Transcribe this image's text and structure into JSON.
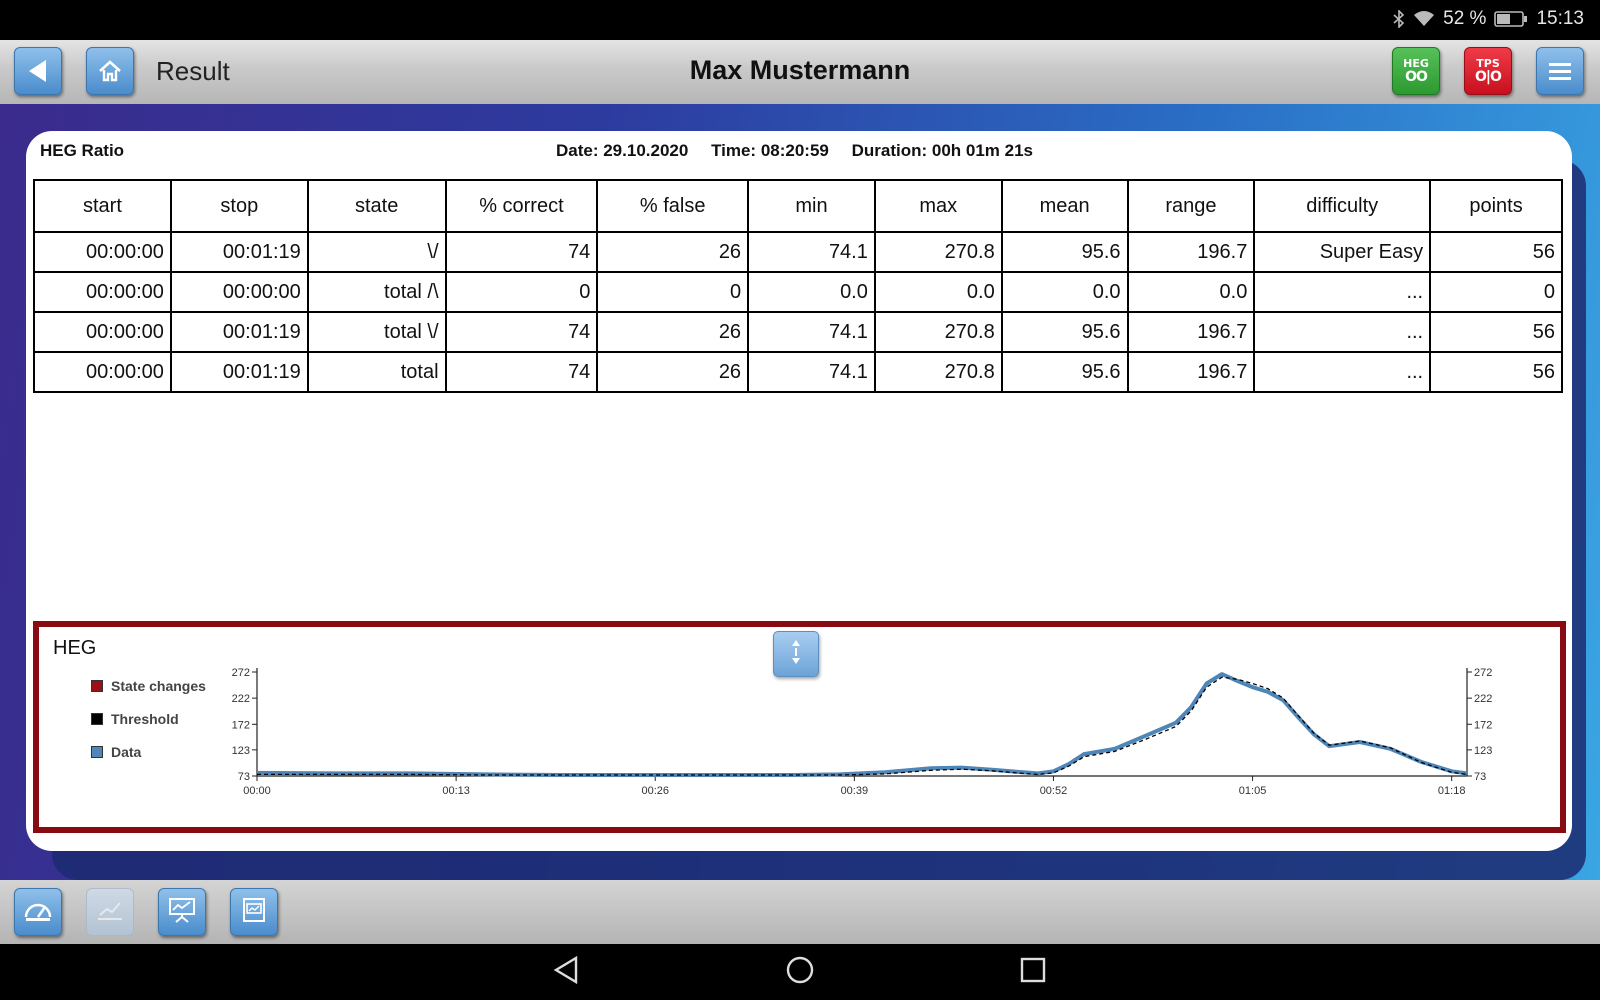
{
  "status_bar": {
    "battery_percent": "52 %",
    "time": "15:13",
    "icons": [
      "bluetooth-icon",
      "wifi-icon",
      "battery-icon"
    ]
  },
  "toolbar": {
    "title": "Result",
    "patient_name": "Max Mustermann",
    "heg_device": {
      "top": "HEG",
      "bottom": "OO"
    },
    "tps_device": {
      "top": "TPS",
      "bottom": "O|O"
    },
    "icons": [
      "back-arrow-icon",
      "home-icon",
      "menu-icon"
    ]
  },
  "card": {
    "title": "HEG Ratio",
    "date": "Date: 29.10.2020",
    "time": "Time: 08:20:59",
    "duration": "Duration: 00h 01m 21s"
  },
  "table": {
    "headers": [
      "start",
      "stop",
      "state",
      "% correct",
      "% false",
      "min",
      "max",
      "mean",
      "range",
      "difficulty",
      "points"
    ],
    "rows": [
      [
        "00:00:00",
        "00:01:19",
        "\\/",
        "74",
        "26",
        "74.1",
        "270.8",
        "95.6",
        "196.7",
        "Super Easy",
        "56"
      ],
      [
        "00:00:00",
        "00:00:00",
        "total /\\",
        "0",
        "0",
        "0.0",
        "0.0",
        "0.0",
        "0.0",
        "...",
        "0"
      ],
      [
        "00:00:00",
        "00:01:19",
        "total \\/",
        "74",
        "26",
        "74.1",
        "270.8",
        "95.6",
        "196.7",
        "...",
        "56"
      ],
      [
        "00:00:00",
        "00:01:19",
        "total",
        "74",
        "26",
        "74.1",
        "270.8",
        "95.6",
        "196.7",
        "...",
        "56"
      ]
    ]
  },
  "chart_panel": {
    "title": "HEG",
    "legend": [
      {
        "label": "State changes",
        "color": "#9b1016"
      },
      {
        "label": "Threshold",
        "color": "#000000"
      },
      {
        "label": "Data",
        "color": "#4f86b8"
      }
    ]
  },
  "chart_data": {
    "type": "line",
    "x_ticks": [
      "00:00",
      "00:13",
      "00:26",
      "00:39",
      "00:52",
      "01:05",
      "01:18"
    ],
    "x_tick_seconds": [
      0,
      13,
      26,
      39,
      52,
      65,
      78
    ],
    "xlim": [
      0,
      79
    ],
    "y_ticks": [
      73,
      123,
      172,
      222,
      272
    ],
    "ylim": [
      73,
      272
    ],
    "grid": false,
    "legend_position": "left",
    "series": [
      {
        "name": "Data",
        "color": "#4f86b8",
        "x": [
          0,
          5,
          10,
          15,
          20,
          25,
          30,
          35,
          38,
          41,
          44,
          46,
          48,
          50,
          51,
          52,
          53,
          54,
          56,
          58,
          60,
          61,
          62,
          63,
          64,
          65,
          66,
          67,
          68,
          69,
          70,
          72,
          74,
          76,
          78,
          79
        ],
        "y": [
          79,
          78,
          78,
          76,
          75,
          75,
          75,
          75,
          76,
          80,
          88,
          89,
          85,
          80,
          78,
          82,
          96,
          115,
          125,
          150,
          175,
          205,
          250,
          268,
          255,
          243,
          234,
          218,
          185,
          153,
          130,
          138,
          125,
          100,
          82,
          78
        ]
      },
      {
        "name": "Threshold",
        "color": "#000000",
        "x": [
          0,
          5,
          10,
          15,
          20,
          25,
          30,
          35,
          38,
          41,
          44,
          46,
          48,
          50,
          51,
          52,
          53,
          54,
          56,
          58,
          60,
          61,
          62,
          63,
          64,
          65,
          66,
          67,
          68,
          69,
          70,
          72,
          74,
          76,
          78,
          79
        ],
        "y": [
          76,
          76,
          76,
          75,
          75,
          75,
          75,
          75,
          75,
          77,
          84,
          86,
          83,
          78,
          76,
          79,
          92,
          110,
          120,
          143,
          168,
          198,
          243,
          262,
          258,
          250,
          240,
          222,
          188,
          155,
          132,
          140,
          127,
          99,
          80,
          76
        ]
      }
    ]
  },
  "bottom_bar": {
    "icons": [
      "gauge-icon",
      "edit-chart-icon",
      "presentation-icon",
      "report-icon"
    ]
  },
  "nav_bar": {
    "icons": [
      "nav-back-icon",
      "nav-home-icon",
      "nav-recents-icon"
    ]
  }
}
